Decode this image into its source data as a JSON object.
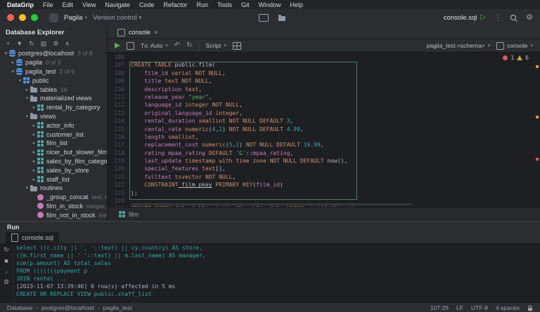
{
  "menubar": {
    "items": [
      "DataGrip",
      "File",
      "Edit",
      "View",
      "Navigate",
      "Code",
      "Refactor",
      "Run",
      "Tools",
      "Git",
      "Window",
      "Help"
    ]
  },
  "titlebar": {
    "project": "Pagila",
    "vcs": "Version control",
    "run_config": "console.sql"
  },
  "explorer": {
    "title": "Database Explorer",
    "tools": [
      "add",
      "filter",
      "refresh",
      "console",
      "settings",
      "collapse"
    ],
    "tree": [
      {
        "lvl": 0,
        "ch": "v",
        "icon": "server",
        "label": "postgres@localhost",
        "meta": "3 of 8"
      },
      {
        "lvl": 1,
        "ch": ">",
        "icon": "db",
        "label": "pagila",
        "meta": "0 of 3"
      },
      {
        "lvl": 1,
        "ch": "v",
        "icon": "db",
        "label": "pagila_test",
        "meta": "2 of 9"
      },
      {
        "lvl": 2,
        "ch": "v",
        "icon": "schema",
        "label": "public"
      },
      {
        "lvl": 3,
        "ch": ">",
        "icon": "folder",
        "label": "tables",
        "meta": "19"
      },
      {
        "lvl": 3,
        "ch": "v",
        "icon": "folder",
        "label": "materialized views"
      },
      {
        "lvl": 4,
        "ch": ">",
        "icon": "view",
        "label": "rental_by_category"
      },
      {
        "lvl": 3,
        "ch": "v",
        "icon": "folder",
        "label": "views"
      },
      {
        "lvl": 4,
        "ch": ">",
        "icon": "view",
        "label": "actor_info"
      },
      {
        "lvl": 4,
        "ch": ">",
        "icon": "view",
        "label": "customer_list"
      },
      {
        "lvl": 4,
        "ch": ">",
        "icon": "view",
        "label": "film_list"
      },
      {
        "lvl": 4,
        "ch": ">",
        "icon": "view",
        "label": "nicer_but_slower_film_list"
      },
      {
        "lvl": 4,
        "ch": ">",
        "icon": "view",
        "label": "sales_by_film_category"
      },
      {
        "lvl": 4,
        "ch": ">",
        "icon": "view",
        "label": "sales_by_store"
      },
      {
        "lvl": 4,
        "ch": ">",
        "icon": "view",
        "label": "staff_list"
      },
      {
        "lvl": 3,
        "ch": "v",
        "icon": "folder",
        "label": "routines"
      },
      {
        "lvl": 4,
        "ch": "",
        "icon": "routine",
        "label": "_group_concat",
        "meta": "text, text"
      },
      {
        "lvl": 4,
        "ch": "",
        "icon": "routine",
        "label": "film_in_stock",
        "meta": "integer, integer"
      },
      {
        "lvl": 4,
        "ch": "",
        "icon": "routine",
        "label": "film_not_in_stock",
        "meta": "integer, in"
      }
    ]
  },
  "editor": {
    "tab": "console",
    "toolbar": {
      "tx": "Tx: Auto",
      "script": "Script"
    },
    "schema_switcher": "pagila_test.<schema>",
    "session": "console",
    "inspections": {
      "errors": "1",
      "warnings": "6"
    },
    "gutter_start": 106,
    "breadcrumb": "film",
    "lines": [
      [],
      [
        [
          "k",
          "CREATE TABLE"
        ],
        [
          "p",
          " public.film("
        ]
      ],
      [
        [
          "p",
          "    "
        ],
        [
          "i",
          "film_id"
        ],
        [
          "k",
          " serial NOT NULL"
        ],
        [
          "p",
          ","
        ]
      ],
      [
        [
          "p",
          "    "
        ],
        [
          "i",
          "title"
        ],
        [
          "k",
          " text NOT NULL"
        ],
        [
          "p",
          ","
        ]
      ],
      [
        [
          "p",
          "    "
        ],
        [
          "i",
          "description"
        ],
        [
          "k",
          " text"
        ],
        [
          "p",
          ","
        ]
      ],
      [
        [
          "p",
          "    "
        ],
        [
          "i",
          "release_year"
        ],
        [
          "s",
          " \"year\""
        ],
        [
          "p",
          ","
        ]
      ],
      [
        [
          "p",
          "    "
        ],
        [
          "i",
          "language_id"
        ],
        [
          "k",
          " integer NOT NULL"
        ],
        [
          "p",
          ","
        ]
      ],
      [
        [
          "p",
          "    "
        ],
        [
          "i",
          "original_language_id"
        ],
        [
          "k",
          " integer"
        ],
        [
          "p",
          ","
        ]
      ],
      [
        [
          "p",
          "    "
        ],
        [
          "i",
          "rental_duration"
        ],
        [
          "k",
          " smallint NOT NULL DEFAULT"
        ],
        [
          "n",
          " 3"
        ],
        [
          "p",
          ","
        ]
      ],
      [
        [
          "p",
          "    "
        ],
        [
          "i",
          "rental_rate"
        ],
        [
          "k",
          " numeric"
        ],
        [
          "p",
          "("
        ],
        [
          "n",
          "4"
        ],
        [
          "p",
          ","
        ],
        [
          "n",
          "2"
        ],
        [
          "p",
          ")"
        ],
        [
          "k",
          " NOT NULL DEFAULT"
        ],
        [
          "n",
          " 4.99"
        ],
        [
          "p",
          ","
        ]
      ],
      [
        [
          "p",
          "    "
        ],
        [
          "i",
          "length"
        ],
        [
          "k",
          " smallint"
        ],
        [
          "p",
          ","
        ]
      ],
      [
        [
          "p",
          "    "
        ],
        [
          "i",
          "replacement_cost"
        ],
        [
          "k",
          " numeric"
        ],
        [
          "p",
          "("
        ],
        [
          "n",
          "5"
        ],
        [
          "p",
          ","
        ],
        [
          "n",
          "2"
        ],
        [
          "p",
          ")"
        ],
        [
          "k",
          " NOT NULL DEFAULT"
        ],
        [
          "n",
          " 19.99"
        ],
        [
          "p",
          ","
        ]
      ],
      [
        [
          "p",
          "    "
        ],
        [
          "i",
          "rating mpaa_rating"
        ],
        [
          "k",
          " DEFAULT"
        ],
        [
          "s",
          " 'G'"
        ],
        [
          "p",
          "::"
        ],
        [
          "i",
          "mpaa_rating"
        ],
        [
          "p",
          ","
        ]
      ],
      [
        [
          "p",
          "    "
        ],
        [
          "i",
          "last_update"
        ],
        [
          "k",
          " timestamp with time zone NOT NULL DEFAULT"
        ],
        [
          "p",
          " now(),"
        ]
      ],
      [
        [
          "p",
          "    "
        ],
        [
          "i",
          "special_features"
        ],
        [
          "k",
          " text"
        ],
        [
          "p",
          "[],"
        ]
      ],
      [
        [
          "p",
          "    "
        ],
        [
          "i",
          "fulltext"
        ],
        [
          "k",
          " tsvector NOT NULL"
        ],
        [
          "p",
          ","
        ]
      ],
      [
        [
          "p",
          "    "
        ],
        [
          "k",
          "CONSTRAINT"
        ],
        [
          "u",
          " film_pkey"
        ],
        [
          "k",
          " PRIMARY KEY"
        ],
        [
          "p",
          "("
        ],
        [
          "i",
          "film_id"
        ],
        [
          "p",
          ")"
        ]
      ],
      [
        [
          "p",
          ");"
        ]
      ],
      [],
      [
        [
          "k",
          "CREATE INDEX"
        ],
        [
          "u",
          " film_fulltext_idx"
        ],
        [
          "k",
          " ON"
        ],
        [
          "p",
          " public.film"
        ],
        [
          "k",
          " USING"
        ],
        [
          "p",
          " gist("
        ],
        [
          "i",
          "fulltext"
        ],
        [
          "p",
          ");"
        ]
      ]
    ]
  },
  "run_panel": {
    "title": "Run",
    "tab": "console.sql",
    "tools": [
      "rerun",
      "stop",
      "down",
      "gear"
    ],
    "output": [
      {
        "c": "sql",
        "t": "select ((c.city || ', '::text) || cy.country) AS store,"
      },
      {
        "c": "sql",
        "t": "((m.first_name || ' '::text) || m.last_name) AS manager,"
      },
      {
        "c": "sql",
        "t": "sum(p.amount) AS total_sales"
      },
      {
        "c": "sql",
        "t": "FROM (((((((payment p"
      },
      {
        "c": "sql",
        "t": "JOIN rental ..."
      },
      {
        "c": "log",
        "t": "[2023-11-07 13:39:46] 0 row(s) affected in 5 ms"
      },
      {
        "c": "sql",
        "t": "CREATE OR REPLACE VIEW public.staff_list"
      }
    ]
  },
  "statusbar": {
    "path": [
      "Database",
      "postgres@localhost",
      "pagila_test"
    ],
    "widgets": [
      "107:26",
      "LF",
      "UTF-8",
      "4 spaces"
    ]
  }
}
